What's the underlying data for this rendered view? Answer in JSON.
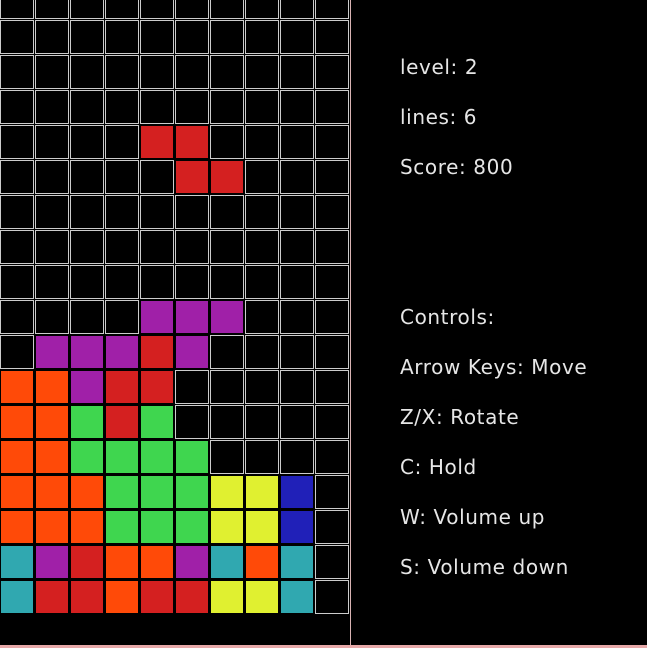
{
  "stats": {
    "level": "level: 2",
    "lines": "lines: 6",
    "score": "Score: 800"
  },
  "controls": {
    "title": "Controls:",
    "items": [
      "Arrow Keys: Move",
      "Z/X: Rotate",
      "C: Hold",
      "W: Volume up",
      "S: Volume down"
    ]
  },
  "colors": {
    "R": "#d42020",
    "P": "#a020a8",
    "O": "#ff4a08",
    "G": "#3fd64f",
    "Y": "#e0f030",
    "B": "#2020b8",
    "T": "#30a8b0",
    "grid": "#cccccc",
    "empty": "#000000"
  },
  "board": {
    "cols": 10,
    "rows": [
      "..........",
      "..........",
      "..........",
      "..........",
      "....RR....",
      ".....RR...",
      "..........",
      "..........",
      "..........",
      "....PPP...",
      ".PPPRP....",
      "OOPRR.....",
      "OOGRG.....",
      "OOGGGG....",
      "OOOGGGYYB.",
      "OOOGGGYYB.",
      "TPROOPTOT.",
      "TRRORRYYT."
    ]
  }
}
